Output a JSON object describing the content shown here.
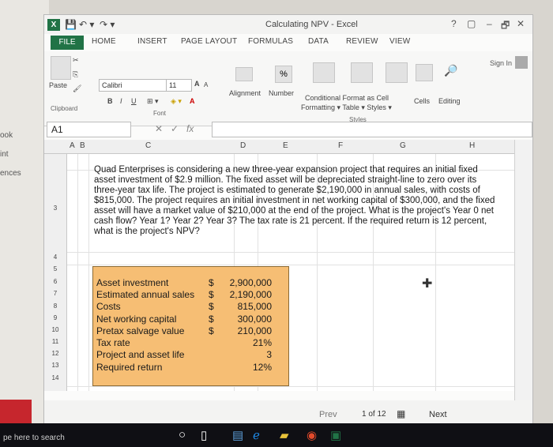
{
  "background_page": {
    "words": [
      "ook",
      "int",
      "ences"
    ],
    "search_placeholder": "pe here to search"
  },
  "app": {
    "title": "Calculating NPV - Excel",
    "sign_in": "Sign In",
    "win_controls": [
      "?",
      "▢",
      "–",
      "🗗",
      "✕"
    ],
    "xl_icon": "X"
  },
  "tabs": [
    "FILE",
    "HOME",
    "INSERT",
    "PAGE LAYOUT",
    "FORMULAS",
    "DATA",
    "REVIEW",
    "VIEW"
  ],
  "ribbon": {
    "paste": "Paste",
    "clipboard": "Clipboard",
    "font_group": "Font",
    "font_name": "Calibri",
    "font_size": "11",
    "bold": "B",
    "italic": "I",
    "underline": "U",
    "grow": "A",
    "shrink": "A",
    "fill_color": "A",
    "alignment": "Alignment",
    "number": "Number",
    "percent": "%",
    "conditional": "Conditional Format as Cell",
    "formatting": "Formatting ▾ Table ▾ Styles ▾",
    "styles": "Styles",
    "cells": "Cells",
    "editing": "Editing"
  },
  "formula_bar": {
    "name_box": "A1",
    "fx": "fx",
    "cancel": "✕",
    "enter": "✓"
  },
  "columns": [
    "A",
    "B",
    "C",
    "D",
    "E",
    "F",
    "G",
    "H"
  ],
  "rows": [
    "3",
    "4",
    "5",
    "6",
    "7",
    "8",
    "9",
    "10",
    "11",
    "12",
    "13",
    "14"
  ],
  "problem_text": "Quad Enterprises is considering a new three-year expansion project that requires an initial fixed asset investment of $2.9 million. The fixed asset will be depreciated straight-line to zero over its three-year tax life. The project is estimated to generate $2,190,000 in annual sales, with costs of $815,000. The project requires an initial investment in net working capital of $300,000, and the fixed asset will have a market value of $210,000 at the end of the project. What is the project's Year 0 net cash flow? Year 1? Year 2? Year 3? The tax rate is 21 percent. If the required return is 12 percent, what is the project's NPV?",
  "inputs": [
    {
      "label": "Asset investment",
      "dollar": "$",
      "value": "2,900,000"
    },
    {
      "label": "Estimated annual sales",
      "dollar": "$",
      "value": "2,190,000"
    },
    {
      "label": "Costs",
      "dollar": "$",
      "value": "815,000"
    },
    {
      "label": "Net working capital",
      "dollar": "$",
      "value": "300,000"
    },
    {
      "label": "Pretax salvage value",
      "dollar": "$",
      "value": "210,000"
    },
    {
      "label": "Tax rate",
      "dollar": "",
      "value": "21%"
    },
    {
      "label": "Project and asset life",
      "dollar": "",
      "value": "3"
    },
    {
      "label": "Required return",
      "dollar": "",
      "value": "12%"
    }
  ],
  "status": {
    "prev": "Prev",
    "page": "1 of 12",
    "next": "Next"
  },
  "colors": {
    "excel_green": "#217346",
    "input_fill": "#f6be74"
  }
}
